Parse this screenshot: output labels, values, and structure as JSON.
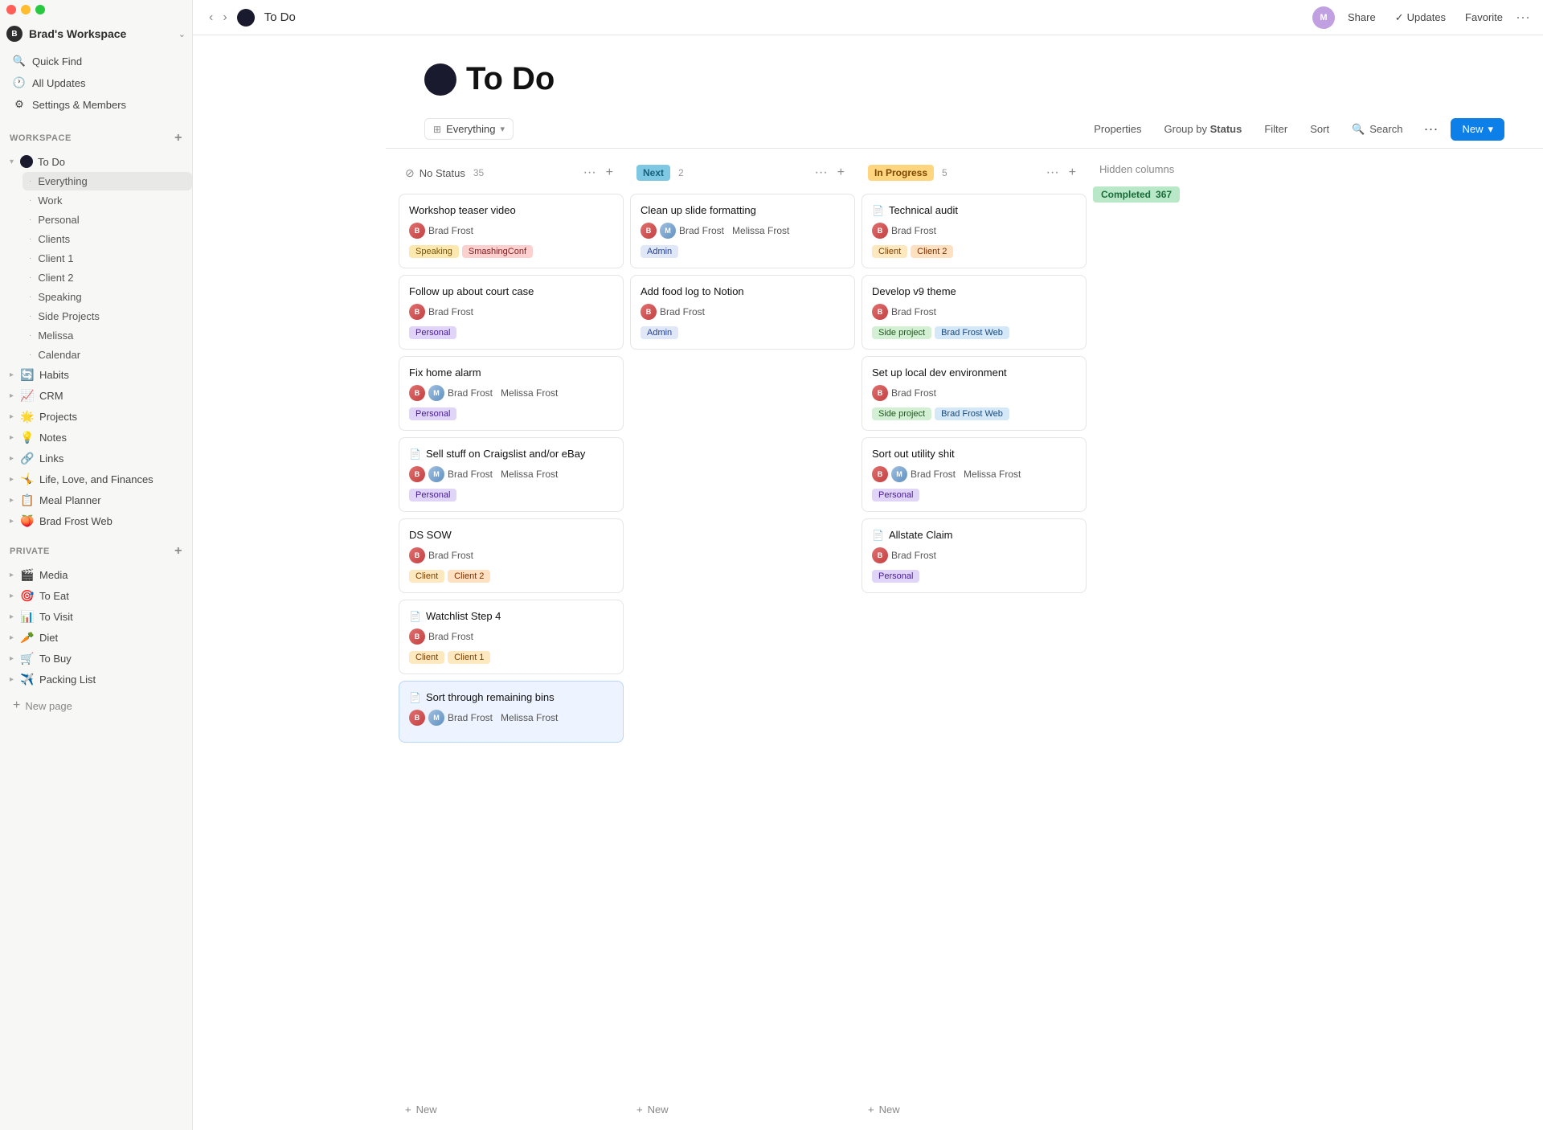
{
  "app": {
    "title": "To Do",
    "workspace": "Brad's Workspace"
  },
  "titlebar": {
    "title": "To Do",
    "share_label": "Share",
    "updates_label": "Updates",
    "favorite_label": "Favorite"
  },
  "sidebar": {
    "workspace_label": "Brad's Workspace",
    "quick_find": "Quick Find",
    "all_updates": "All Updates",
    "settings": "Settings & Members",
    "workspace_section": "WORKSPACE",
    "private_section": "PRIVATE",
    "new_page": "New page",
    "workspace_items": [
      {
        "id": "todo",
        "label": "To Do",
        "icon": "●",
        "expanded": true
      },
      {
        "id": "everything",
        "label": "Everything",
        "sub": true,
        "active": true
      },
      {
        "id": "work",
        "label": "Work",
        "sub": true
      },
      {
        "id": "personal",
        "label": "Personal",
        "sub": true
      },
      {
        "id": "clients",
        "label": "Clients",
        "sub": true
      },
      {
        "id": "client1",
        "label": "Client 1",
        "sub": true
      },
      {
        "id": "client2",
        "label": "Client 2",
        "sub": true
      },
      {
        "id": "speaking",
        "label": "Speaking",
        "sub": true
      },
      {
        "id": "side-projects",
        "label": "Side Projects",
        "sub": true
      },
      {
        "id": "melissa",
        "label": "Melissa",
        "sub": true
      },
      {
        "id": "calendar",
        "label": "Calendar",
        "sub": true
      },
      {
        "id": "habits",
        "label": "Habits",
        "icon": "🔄"
      },
      {
        "id": "crm",
        "label": "CRM",
        "icon": "📈"
      },
      {
        "id": "projects",
        "label": "Projects",
        "icon": "🌟"
      },
      {
        "id": "notes",
        "label": "Notes",
        "icon": "💡"
      },
      {
        "id": "links",
        "label": "Links",
        "icon": "🔗"
      },
      {
        "id": "life-love-finances",
        "label": "Life, Love, and Finances",
        "icon": "🤸"
      },
      {
        "id": "meal-planner",
        "label": "Meal Planner",
        "icon": "📋"
      },
      {
        "id": "brad-frost-web",
        "label": "Brad Frost Web",
        "icon": "🍑"
      }
    ],
    "private_items": [
      {
        "id": "media",
        "label": "Media",
        "icon": "🎬"
      },
      {
        "id": "to-eat",
        "label": "To Eat",
        "icon": "🎯"
      },
      {
        "id": "to-visit",
        "label": "To Visit",
        "icon": "📊"
      },
      {
        "id": "diet",
        "label": "Diet",
        "icon": "🥕"
      },
      {
        "id": "to-buy",
        "label": "To Buy",
        "icon": "🛒"
      },
      {
        "id": "packing-list",
        "label": "Packing List",
        "icon": "✈️"
      }
    ]
  },
  "toolbar": {
    "view_icon": "⊞",
    "view_label": "Everything",
    "properties_label": "Properties",
    "group_by_label": "Group by",
    "group_by_value": "Status",
    "filter_label": "Filter",
    "sort_label": "Sort",
    "search_label": "Search",
    "more_label": "···",
    "new_label": "New",
    "new_chevron": "▾"
  },
  "board": {
    "columns": [
      {
        "id": "no-status",
        "label": "No Status",
        "icon": "⊘",
        "count": 35,
        "cards": [
          {
            "id": "c1",
            "title": "Workshop teaser video",
            "assignees": [
              {
                "name": "Brad Frost",
                "type": "brad"
              }
            ],
            "tags": [
              {
                "label": "Speaking",
                "type": "speaking"
              },
              {
                "label": "SmashingConf",
                "type": "smashingconf"
              }
            ]
          },
          {
            "id": "c2",
            "title": "Follow up about court case",
            "assignees": [
              {
                "name": "Brad Frost",
                "type": "brad"
              }
            ],
            "tags": [
              {
                "label": "Personal",
                "type": "personal"
              }
            ]
          },
          {
            "id": "c3",
            "title": "Fix home alarm",
            "assignees": [
              {
                "name": "Brad Frost",
                "type": "brad"
              },
              {
                "name": "Melissa Frost",
                "type": "melissa"
              }
            ],
            "tags": [
              {
                "label": "Personal",
                "type": "personal"
              }
            ]
          },
          {
            "id": "c4",
            "title": "Sell stuff on Craigslist and/or eBay",
            "doc": true,
            "assignees": [
              {
                "name": "Brad Frost",
                "type": "brad"
              },
              {
                "name": "Melissa Frost",
                "type": "melissa"
              }
            ],
            "tags": [
              {
                "label": "Personal",
                "type": "personal"
              }
            ]
          },
          {
            "id": "c5",
            "title": "DS SOW",
            "assignees": [
              {
                "name": "Brad Frost",
                "type": "brad"
              }
            ],
            "tags": [
              {
                "label": "Client",
                "type": "client"
              },
              {
                "label": "Client 2",
                "type": "client2"
              }
            ]
          },
          {
            "id": "c6",
            "title": "Watchlist Step 4",
            "doc": true,
            "assignees": [
              {
                "name": "Brad Frost",
                "type": "brad"
              }
            ],
            "tags": [
              {
                "label": "Client",
                "type": "client"
              },
              {
                "label": "Client 1",
                "type": "client1"
              }
            ]
          },
          {
            "id": "c7",
            "title": "Sort through remaining bins",
            "doc": true,
            "assignees": [
              {
                "name": "Brad Frost",
                "type": "brad"
              },
              {
                "name": "Melissa Frost",
                "type": "melissa"
              }
            ],
            "tags": [],
            "highlighted": true
          }
        ]
      },
      {
        "id": "next",
        "label": "Next",
        "count": 2,
        "cards": [
          {
            "id": "n1",
            "title": "Clean up slide formatting",
            "assignees": [
              {
                "name": "Brad Frost",
                "type": "brad"
              },
              {
                "name": "Melissa Frost",
                "type": "melissa"
              }
            ],
            "tags": [
              {
                "label": "Admin",
                "type": "admin"
              }
            ]
          },
          {
            "id": "n2",
            "title": "Add food log to Notion",
            "assignees": [
              {
                "name": "Brad Frost",
                "type": "brad"
              }
            ],
            "tags": [
              {
                "label": "Admin",
                "type": "admin"
              }
            ]
          }
        ]
      },
      {
        "id": "in-progress",
        "label": "In Progress",
        "count": 5,
        "cards": [
          {
            "id": "ip1",
            "title": "Technical audit",
            "doc": true,
            "assignees": [
              {
                "name": "Brad Frost",
                "type": "brad"
              }
            ],
            "tags": [
              {
                "label": "Client",
                "type": "client"
              },
              {
                "label": "Client 2",
                "type": "client2"
              }
            ]
          },
          {
            "id": "ip2",
            "title": "Develop v9 theme",
            "assignees": [
              {
                "name": "Brad Frost",
                "type": "brad"
              }
            ],
            "tags": [
              {
                "label": "Side project",
                "type": "side-project"
              },
              {
                "label": "Brad Frost Web",
                "type": "brad-frost-web"
              }
            ]
          },
          {
            "id": "ip3",
            "title": "Set up local dev environment",
            "assignees": [
              {
                "name": "Brad Frost",
                "type": "brad"
              }
            ],
            "tags": [
              {
                "label": "Side project",
                "type": "side-project"
              },
              {
                "label": "Brad Frost Web",
                "type": "brad-frost-web"
              }
            ]
          },
          {
            "id": "ip4",
            "title": "Sort out utility shit",
            "assignees": [
              {
                "name": "Brad Frost",
                "type": "brad"
              },
              {
                "name": "Melissa Frost",
                "type": "melissa"
              }
            ],
            "tags": [
              {
                "label": "Personal",
                "type": "personal"
              }
            ]
          },
          {
            "id": "ip5",
            "title": "Allstate Claim",
            "doc": true,
            "assignees": [
              {
                "name": "Brad Frost",
                "type": "brad"
              }
            ],
            "tags": [
              {
                "label": "Personal",
                "type": "personal"
              }
            ]
          }
        ]
      }
    ],
    "hidden_columns_label": "Hidden columns",
    "completed_label": "Completed",
    "completed_count": 367,
    "add_new_label": "+ New"
  }
}
